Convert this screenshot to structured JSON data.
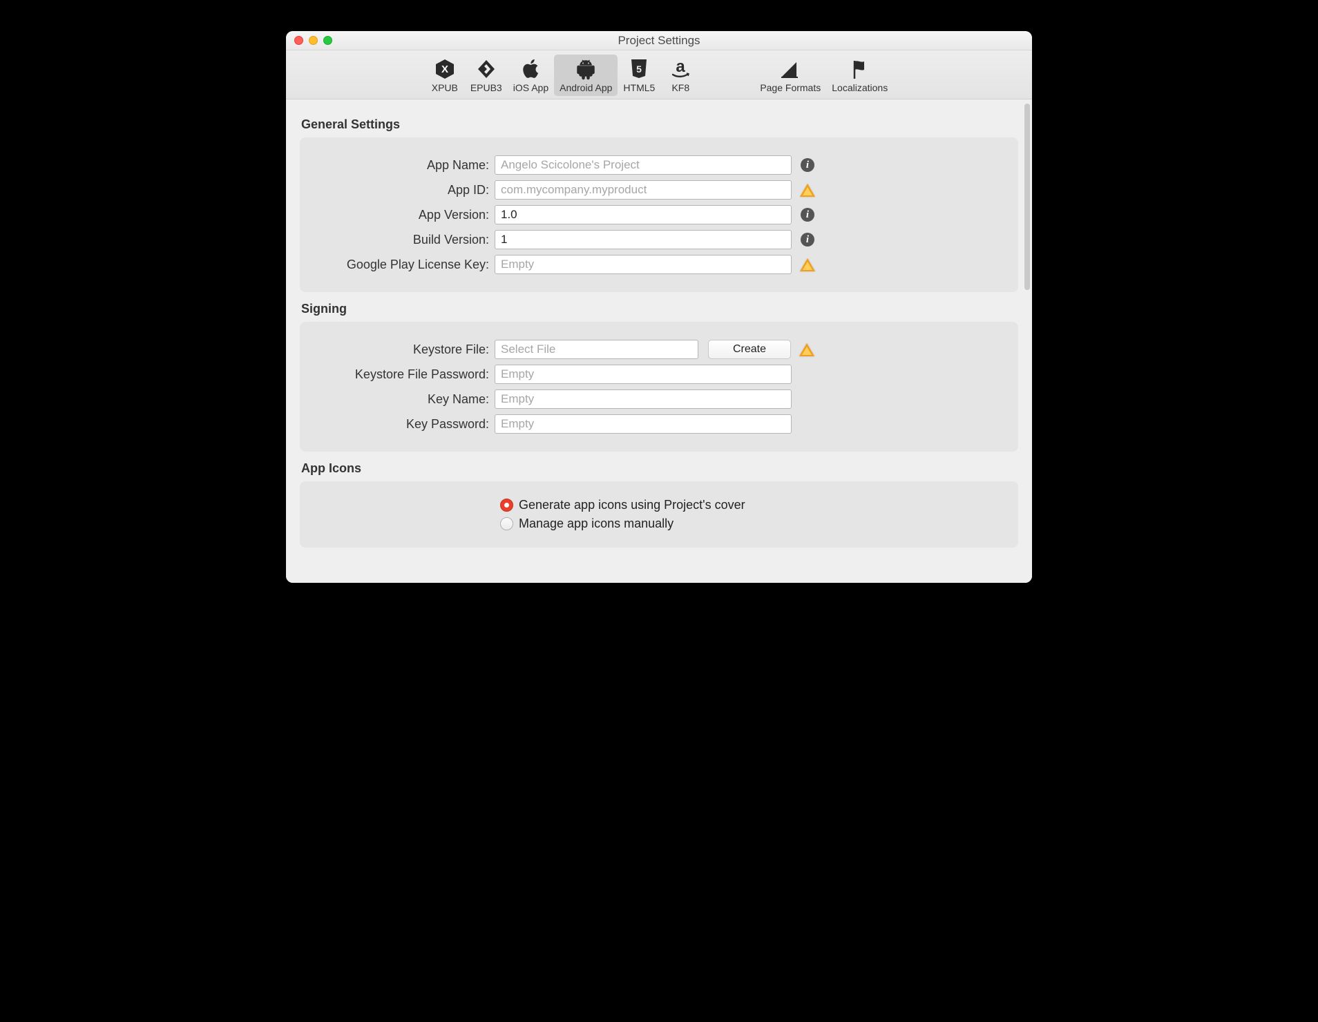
{
  "window": {
    "title": "Project Settings"
  },
  "toolbar": {
    "items": [
      {
        "label": "XPUB"
      },
      {
        "label": "EPUB3"
      },
      {
        "label": "iOS App"
      },
      {
        "label": "Android App"
      },
      {
        "label": "HTML5"
      },
      {
        "label": "KF8"
      }
    ],
    "items2": [
      {
        "label": "Page Formats"
      },
      {
        "label": "Localizations"
      }
    ],
    "selected": "Android App"
  },
  "sections": {
    "general": {
      "title": "General Settings",
      "rows": {
        "app_name": {
          "label": "App Name:",
          "placeholder": "Angelo Scicolone's Project",
          "value": "",
          "status": "info"
        },
        "app_id": {
          "label": "App ID:",
          "placeholder": "com.mycompany.myproduct",
          "value": "",
          "status": "warn"
        },
        "app_version": {
          "label": "App Version:",
          "placeholder": "",
          "value": "1.0",
          "status": "info"
        },
        "build_version": {
          "label": "Build Version:",
          "placeholder": "",
          "value": "1",
          "status": "info"
        },
        "license_key": {
          "label": "Google Play License Key:",
          "placeholder": "Empty",
          "value": "",
          "status": "warn"
        }
      }
    },
    "signing": {
      "title": "Signing",
      "rows": {
        "keystore_file": {
          "label": "Keystore File:",
          "placeholder": "Select File",
          "value": "",
          "button": "Create",
          "status": "warn"
        },
        "keystore_password": {
          "label": "Keystore File Password:",
          "placeholder": "Empty",
          "value": ""
        },
        "key_name": {
          "label": "Key Name:",
          "placeholder": "Empty",
          "value": ""
        },
        "key_password": {
          "label": "Key Password:",
          "placeholder": "Empty",
          "value": ""
        }
      }
    },
    "app_icons": {
      "title": "App Icons",
      "options": {
        "generate": "Generate app icons using Project's cover",
        "manual": "Manage app icons manually"
      },
      "selected": "generate"
    }
  }
}
